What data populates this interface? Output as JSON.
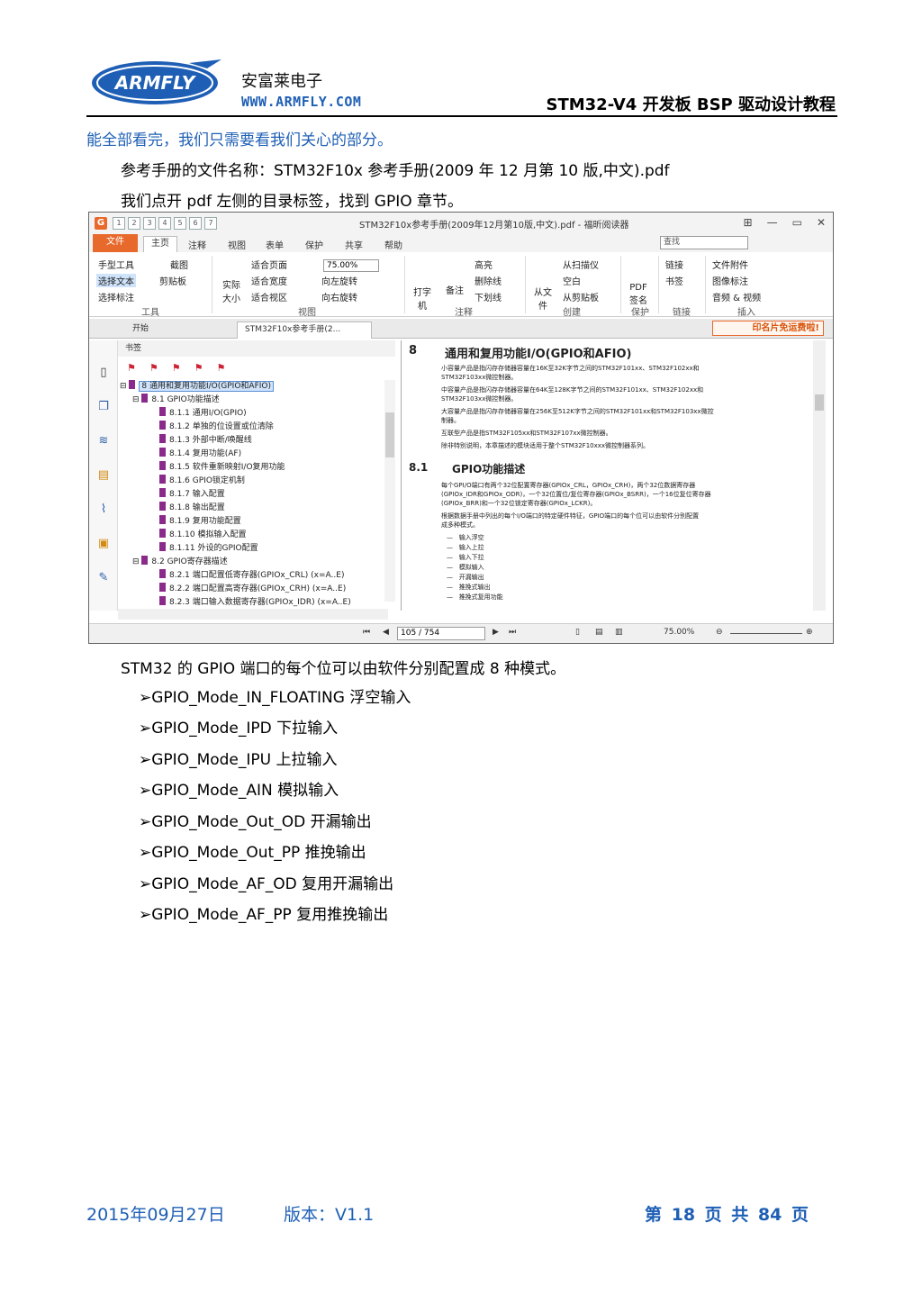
{
  "header": {
    "logo_text": "ARMFLY",
    "company_cn": "安富莱电子",
    "company_url": "WWW.ARMFLY.COM",
    "doc_title": "STM32-V4 开发板 BSP 驱动设计教程"
  },
  "body": {
    "intro": "能全部看完，我们只需要看我们关心的部分。",
    "manual_name": "参考手册的文件名称：STM32F10x 参考手册(2009 年 12 月第 10 版,中文).pdf",
    "open_toc": "我们点开 pdf 左侧的目录标签，找到 GPIO 章节。",
    "modes_intro": "STM32 的 GPIO 端口的每个位可以由软件分别配置成 8 种模式。",
    "modes": [
      "GPIO_Mode_IN_FLOATING  浮空输入",
      "GPIO_Mode_IPD  下拉输入",
      "GPIO_Mode_IPU  上拉输入",
      "GPIO_Mode_AIN  模拟输入",
      "GPIO_Mode_Out_OD  开漏输出",
      "GPIO_Mode_Out_PP  推挽输出",
      "GPIO_Mode_AF_OD  复用开漏输出",
      "GPIO_Mode_AF_PP  复用推挽输出"
    ]
  },
  "screenshot": {
    "window_title": "STM32F10x参考手册(2009年12月第10版,中文).pdf - 福昕阅读器",
    "app_icon": "G",
    "quick_access": [
      "1",
      "2",
      "3",
      "4",
      "5",
      "6",
      "7"
    ],
    "ribbon_tabs": [
      "文件",
      "主页",
      "注释",
      "视图",
      "表单",
      "保护",
      "共享",
      "帮助"
    ],
    "search_placeholder": "查找",
    "ribbon": {
      "hand_tool": "手型工具",
      "select_text": "选择文本",
      "select_annot": "选择标注",
      "snapshot": "截图",
      "clipboard": "剪贴板",
      "group_tools": "工具",
      "actual_size": "实际大小",
      "fit_page": "适合页面",
      "fit_width": "适合宽度",
      "fit_visible": "适合视区",
      "zoom": "75.00%",
      "rotate_left": "向左旋转",
      "rotate_right": "向右旋转",
      "group_view": "视图",
      "typewriter": "打字机",
      "note": "备注",
      "highlight": "高亮",
      "strikeout": "删除线",
      "underline": "下划线",
      "group_annot": "注释",
      "from_file": "从文件",
      "from_scanner": "从扫描仪",
      "blank": "空白",
      "from_clipboard": "从剪贴板",
      "group_create": "创建",
      "pdf_sign": "PDF签名",
      "group_protect": "保护",
      "link": "链接",
      "bookmark": "书签",
      "group_link": "链接",
      "file_attach": "文件附件",
      "image_annot": "图像标注",
      "audio_video": "音频 & 视频",
      "group_insert": "插入"
    },
    "doc_tabs": [
      "开始",
      "STM32F10x参考手册(2..."
    ],
    "promo": "印名片免运费啦!",
    "bookmarks_title": "书签",
    "bookmarks": [
      "8 通用和复用功能I/O(GPIO和AFIO)",
      "8.1 GPIO功能描述",
      "8.1.1 通用I/O(GPIO)",
      "8.1.2 单独的位设置或位清除",
      "8.1.3 外部中断/唤醒线",
      "8.1.4 复用功能(AF)",
      "8.1.5 软件重新映射I/O复用功能",
      "8.1.6 GPIO锁定机制",
      "8.1.7 输入配置",
      "8.1.8 输出配置",
      "8.1.9 复用功能配置",
      "8.1.10 模拟输入配置",
      "8.1.11 外设的GPIO配置",
      "8.2 GPIO寄存器描述",
      "8.2.1 端口配置低寄存器(GPIOx_CRL) (x=A..E)",
      "8.2.2 端口配置高寄存器(GPIOx_CRH) (x=A..E)",
      "8.2.3 端口输入数据寄存器(GPIOx_IDR) (x=A..E)"
    ],
    "page": {
      "ch_num": "8",
      "ch_title": "通用和复用功能I/O(GPIO和AFIO)",
      "lines": [
        "小容量产品是指闪存存储器容量在16K至32K字节之间的STM32F101xx、STM32F102xx和",
        "STM32F103xx微控制器。",
        "中容量产品是指闪存存储器容量在64K至128K字节之间的STM32F101xx、STM32F102xx和",
        "STM32F103xx微控制器。",
        "大容量产品是指闪存存储器容量在256K至512K字节之间的STM32F101xx和STM32F103xx微控",
        "制器。",
        "互联型产品是指STM32F105xx和STM32F107xx微控制器。",
        "除非特别说明，本章描述的模块适用于整个STM32F10xxx微控制器系列。"
      ],
      "sec_num": "8.1",
      "sec_title": "GPIO功能描述",
      "para": [
        "每个GPI/O端口有两个32位配置寄存器(GPIOx_CRL，GPIOx_CRH)，两个32位数据寄存器",
        "(GPIOx_IDR和GPIOx_ODR)，一个32位置位/复位寄存器(GPIOx_BSRR)，一个16位复位寄存器",
        "(GPIOx_BRR)和一个32位锁定寄存器(GPIOx_LCKR)。",
        "根据数据手册中列出的每个I/O端口的特定硬件特征，GPIO端口的每个位可以由软件分别配置",
        "成多种模式。"
      ],
      "bullets": [
        "输入浮空",
        "输入上拉",
        "输入下拉",
        "模拟输入",
        "开漏输出",
        "推挽式输出",
        "推挽式复用功能"
      ]
    },
    "status": {
      "page_input": "105 / 754",
      "zoom": "75.00%"
    }
  },
  "footer": {
    "date": "2015年09月27日",
    "version": "版本：V1.1",
    "page": "第 18 页  共 84 页"
  },
  "colors": {
    "accent_blue": "#1e5fb5",
    "foxit_orange": "#e8692c",
    "bookmark_purple": "#8a2a8a"
  }
}
